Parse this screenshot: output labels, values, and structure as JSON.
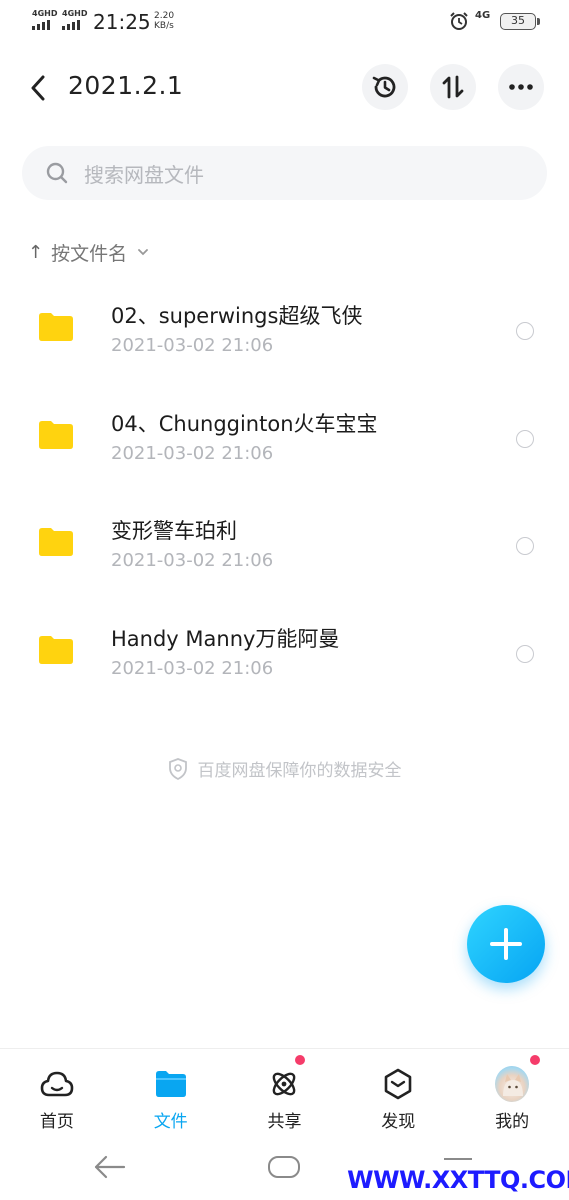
{
  "status_bar": {
    "signal1": "4GHD",
    "signal2": "4GHD",
    "time": "21:25",
    "speed_value": "2.20",
    "speed_unit": "KB/s",
    "network": "4G",
    "battery": "35"
  },
  "header": {
    "title": "2021.2.1",
    "icons": [
      "back-icon",
      "history-icon",
      "sort-icon",
      "more-icon"
    ]
  },
  "search": {
    "placeholder": "搜索网盘文件"
  },
  "sort": {
    "arrow": "↑",
    "label": "按文件名"
  },
  "files": [
    {
      "name": "02、superwings超级飞侠",
      "date": "2021-03-02  21:06"
    },
    {
      "name": "04、Chungginton火车宝宝",
      "date": "2021-03-02  21:06"
    },
    {
      "name": "变形警车珀利",
      "date": "2021-03-02  21:06"
    },
    {
      "name": "Handy Manny万能阿曼",
      "date": "2021-03-02  21:06"
    }
  ],
  "footer_note": "百度网盘保障你的数据安全",
  "bottom_nav": [
    {
      "label": "首页",
      "icon": "cloud-home-icon",
      "active": false,
      "badge": false
    },
    {
      "label": "文件",
      "icon": "folder-icon",
      "active": true,
      "badge": false
    },
    {
      "label": "共享",
      "icon": "atom-icon",
      "active": false,
      "badge": true
    },
    {
      "label": "发现",
      "icon": "discover-icon",
      "active": false,
      "badge": false
    },
    {
      "label": "我的",
      "icon": "avatar",
      "active": false,
      "badge": true
    }
  ],
  "watermark": "WWW.XXTTQ.COM",
  "colors": {
    "accent": "#09a6f1",
    "folder": "#ffd30f",
    "badge": "#f53c6a",
    "watermark": "#1d1bff"
  }
}
